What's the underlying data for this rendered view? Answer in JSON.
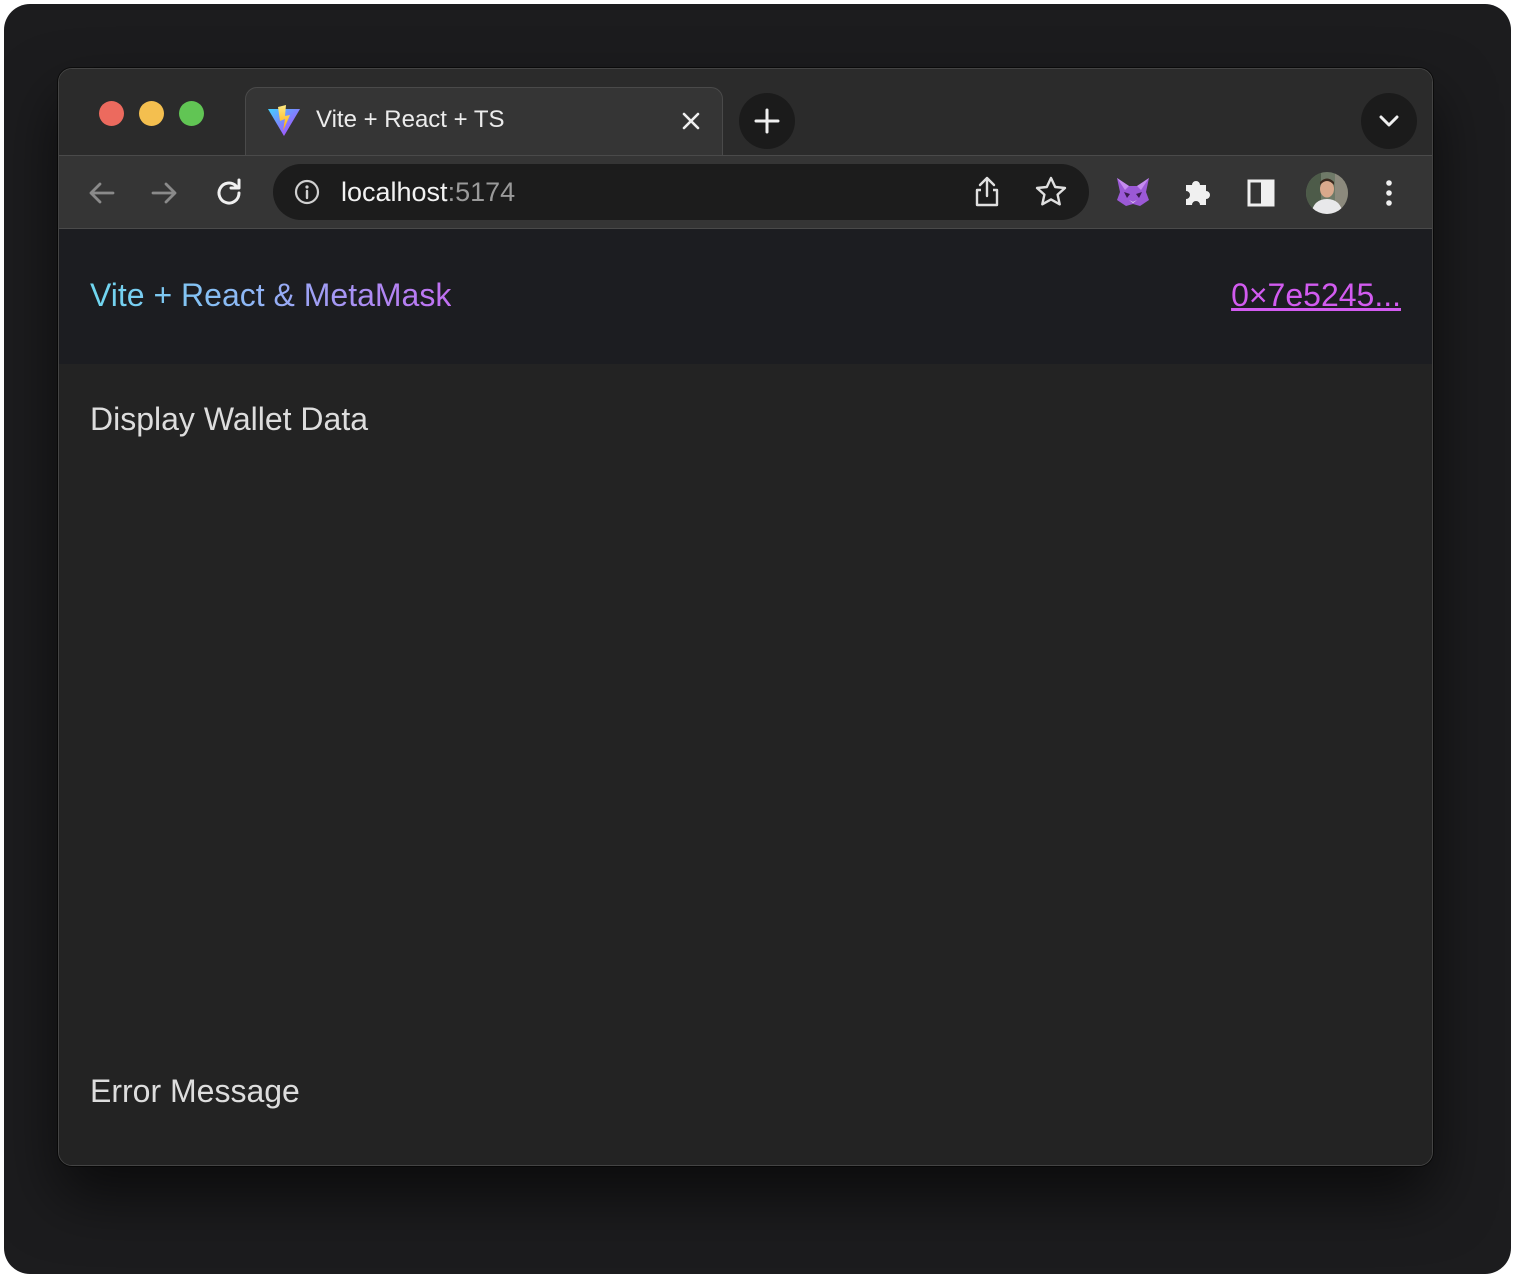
{
  "browser": {
    "tab": {
      "title": "Vite + React + TS",
      "favicon": "vite-logo-icon",
      "close_icon": "close-icon"
    },
    "new_tab_icon": "plus-icon",
    "tab_search_icon": "chevron-down-icon",
    "toolbar": {
      "back_icon": "arrow-left-icon",
      "forward_icon": "arrow-right-icon",
      "reload_icon": "reload-icon",
      "address": {
        "host": "localhost",
        "port": ":5174",
        "info_icon": "info-icon"
      },
      "share_icon": "share-icon",
      "bookmark_icon": "star-icon",
      "extensions": [
        "metamask-fox-icon",
        "puzzle-icon",
        "side-panel-icon"
      ],
      "profile_icon": "avatar",
      "menu_icon": "kebab-menu-icon"
    }
  },
  "page": {
    "header": {
      "title": "Vite + React & MetaMask",
      "wallet_address": "0×7e5245..."
    },
    "wallet_section_title": "Display Wallet Data",
    "error_section_title": "Error Message"
  },
  "colors": {
    "title_gradient": [
      "#6fd7ef",
      "#8fb6f6",
      "#c16ef1"
    ],
    "wallet_link": "#d25bf0",
    "page_bg": "#232323",
    "header_bg": "#1c1d21"
  }
}
